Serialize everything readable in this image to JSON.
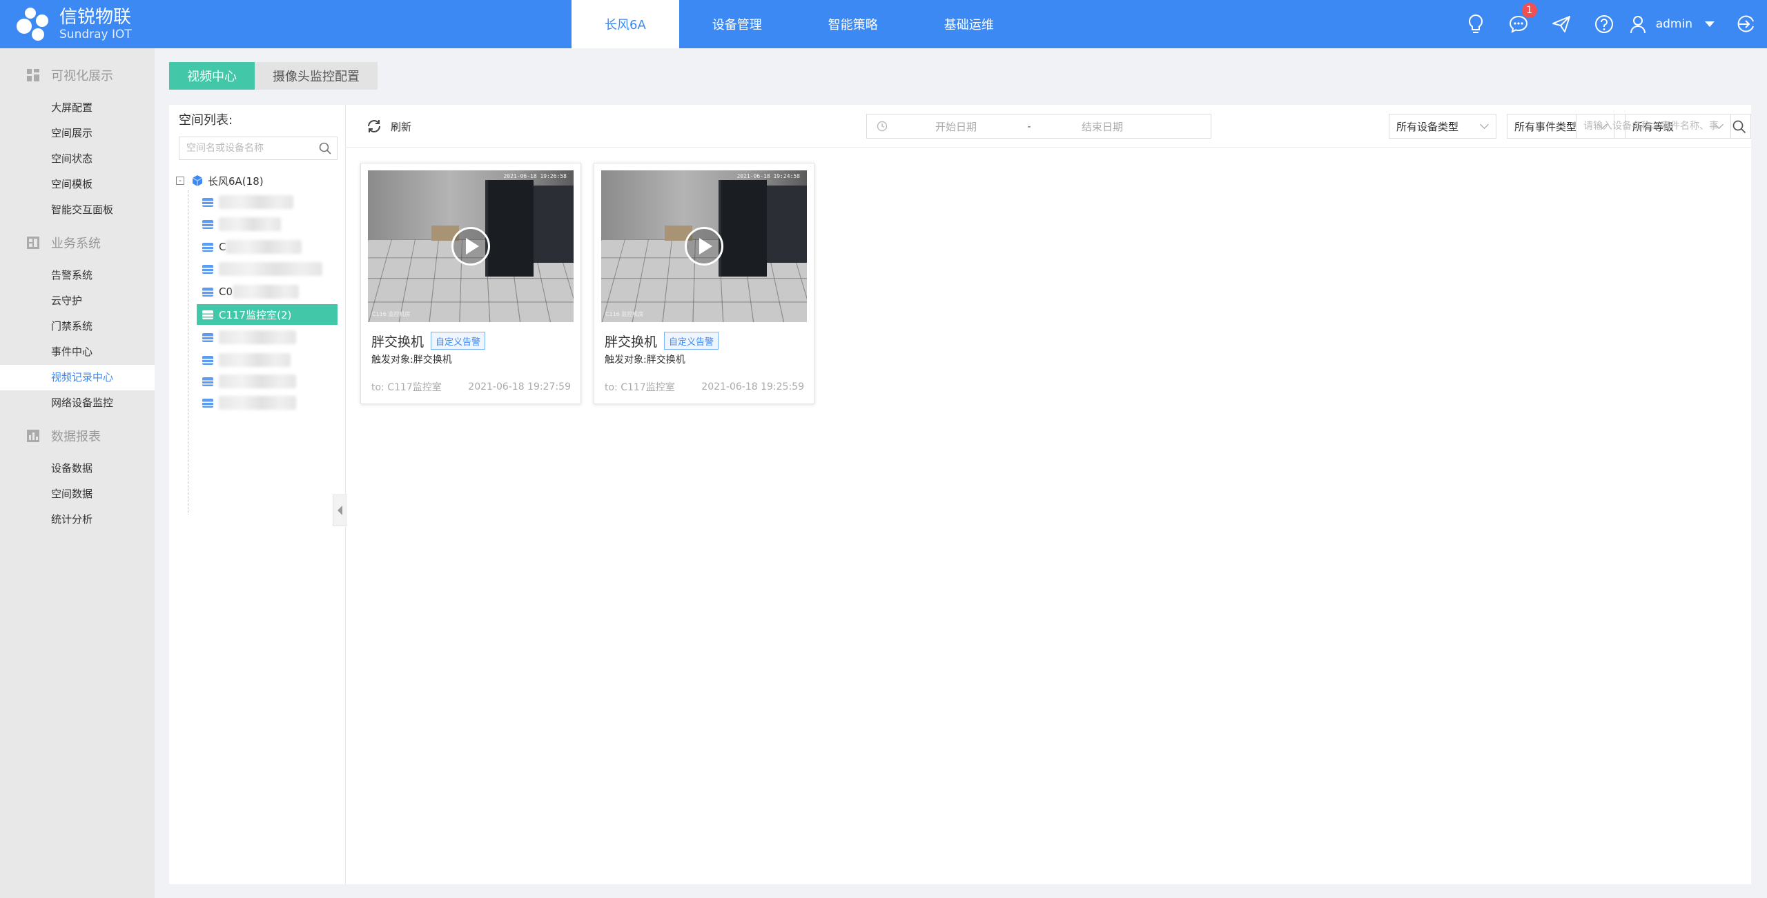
{
  "brand": {
    "name_cn": "信锐物联",
    "name_en": "Sundray IOT"
  },
  "nav": {
    "tabs": [
      {
        "label": "长风6A",
        "active": true
      },
      {
        "label": "设备管理",
        "active": false
      },
      {
        "label": "智能策略",
        "active": false
      },
      {
        "label": "基础运维",
        "active": false
      }
    ]
  },
  "header": {
    "message_badge": "1",
    "user": "admin",
    "icons": [
      "bulb-icon",
      "message-icon",
      "send-icon",
      "help-icon",
      "user-icon",
      "logout-icon"
    ]
  },
  "sidebar": {
    "groups": [
      {
        "label": "可视化展示",
        "icon": "dashboard-icon",
        "items": [
          "大屏配置",
          "空间展示",
          "空间状态",
          "空间模板",
          "智能交互面板"
        ]
      },
      {
        "label": "业务系统",
        "icon": "business-icon",
        "items": [
          "告警系统",
          "云守护",
          "门禁系统",
          "事件中心",
          "视频记录中心",
          "网络设备监控"
        ]
      },
      {
        "label": "数据报表",
        "icon": "report-icon",
        "items": [
          "设备数据",
          "空间数据",
          "统计分析"
        ]
      }
    ],
    "active_item": "视频记录中心"
  },
  "subtabs": [
    {
      "label": "视频中心",
      "active": true
    },
    {
      "label": "摄像头监控配置",
      "active": false
    }
  ],
  "space_tree": {
    "title": "空间列表:",
    "search_placeholder": "空间名或设备名称",
    "root": {
      "toggle": "-",
      "label": "长风6A(18)"
    },
    "items": [
      {
        "label": "",
        "obscured": true
      },
      {
        "label": "",
        "obscured": true
      },
      {
        "label": "C",
        "obscured": true
      },
      {
        "label": "",
        "obscured": true
      },
      {
        "label": "C0",
        "obscured": true
      },
      {
        "label": "C117监控室(2)",
        "obscured": false,
        "active": true
      },
      {
        "label": "",
        "obscured": true
      },
      {
        "label": "",
        "obscured": true
      },
      {
        "label": "",
        "obscured": true
      },
      {
        "label": "",
        "obscured": true
      }
    ]
  },
  "toolbar": {
    "refresh_label": "刷新",
    "start_date_placeholder": "开始日期",
    "date_separator": "-",
    "end_date_placeholder": "结束日期",
    "device_type": "所有设备类型",
    "event_type": "所有事件类型",
    "level": "所有等级",
    "search_placeholder": "请输入设备名称、事件名称、事"
  },
  "videos": [
    {
      "title": "胖交换机",
      "tag": "自定义告警",
      "trigger_label": "触发对象:",
      "trigger_value": "胖交换机",
      "location": "to: C117监控室",
      "time": "2021-06-18 19:27:59",
      "osd_time": "2021-06-18 19:26:58",
      "osd_label": "C116 监控机房"
    },
    {
      "title": "胖交换机",
      "tag": "自定义告警",
      "trigger_label": "触发对象:",
      "trigger_value": "胖交换机",
      "location": "to: C117监控室",
      "time": "2021-06-18 19:25:59",
      "osd_time": "2021-06-18 19:24:58",
      "osd_label": "C116 监控机房"
    }
  ],
  "colors": {
    "primary": "#3d89f4",
    "accent": "#42c8a8",
    "badge": "#f05050"
  }
}
